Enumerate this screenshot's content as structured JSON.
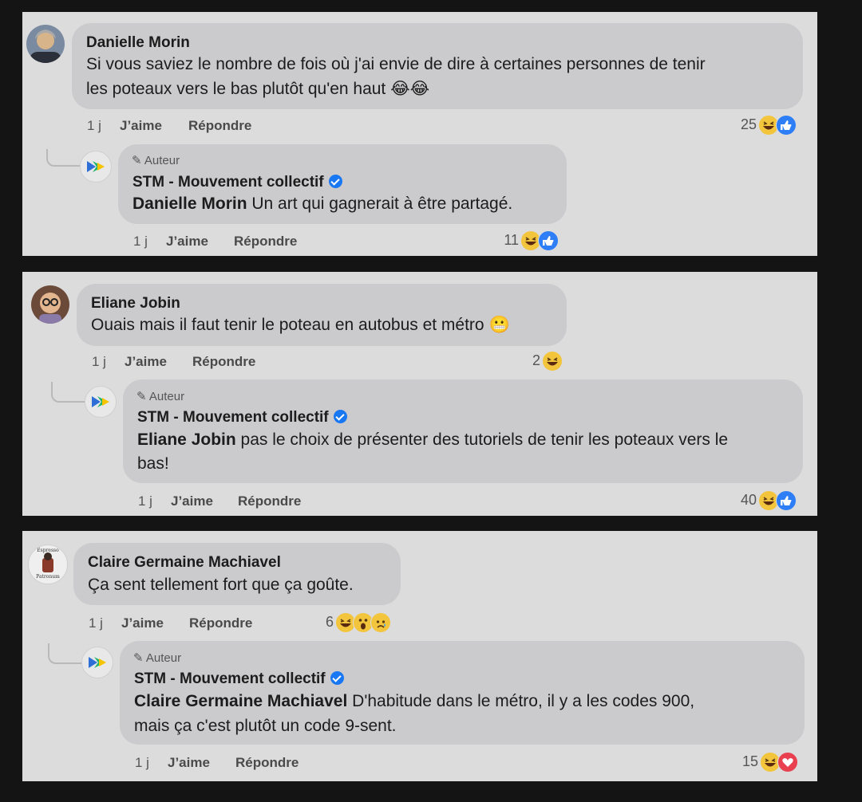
{
  "threads": [
    {
      "comment": {
        "author": "Danielle Morin",
        "line1": "Si vous saviez le nombre de fois où j'ai envie de dire à certaines personnes de tenir",
        "line2": "les poteaux vers le bas plutôt qu'en haut 😂😂",
        "time": "1 j",
        "like": "J’aime",
        "reply": "Répondre",
        "reaction_count": "25",
        "reactions": [
          "haha",
          "like"
        ]
      },
      "reply": {
        "badge": "Auteur",
        "author": "STM - Mouvement collectif",
        "mention": "Danielle Morin",
        "line1": "Un art qui gagnerait à être partagé.",
        "line2": "",
        "time": "1 j",
        "like": "J’aime",
        "reply": "Répondre",
        "reaction_count": "11",
        "reactions": [
          "haha",
          "like"
        ]
      }
    },
    {
      "comment": {
        "author": "Eliane Jobin",
        "line1": "Ouais mais il faut tenir le poteau en autobus et métro 😬",
        "line2": "",
        "time": "1 j",
        "like": "J’aime",
        "reply": "Répondre",
        "reaction_count": "2",
        "reactions": [
          "haha"
        ]
      },
      "reply": {
        "badge": "Auteur",
        "author": "STM - Mouvement collectif",
        "mention": "Eliane Jobin",
        "line1": "pas le choix de présenter des tutoriels de tenir les poteaux vers le",
        "line2": "bas!",
        "time": "1 j",
        "like": "J’aime",
        "reply": "Répondre",
        "reaction_count": "40",
        "reactions": [
          "haha",
          "like"
        ]
      }
    },
    {
      "comment": {
        "author": "Claire Germaine Machiavel",
        "line1": "Ça sent tellement fort que ça goûte.",
        "line2": "",
        "time": "1 j",
        "like": "J’aime",
        "reply": "Répondre",
        "reaction_count": "6",
        "reactions": [
          "haha",
          "wow",
          "sad"
        ]
      },
      "reply": {
        "badge": "Auteur",
        "author": "STM - Mouvement collectif",
        "mention": "Claire Germaine Machiavel",
        "line1": "D'habitude dans le métro, il y a les codes 900,",
        "line2": "mais ça c'est plutôt un code 9-sent.",
        "time": "1 j",
        "like": "J’aime",
        "reply": "Répondre",
        "reaction_count": "15",
        "reactions": [
          "haha",
          "love"
        ]
      }
    }
  ],
  "avatar_logo_text": {
    "top": "Espresso",
    "bottom": "Patronum"
  }
}
